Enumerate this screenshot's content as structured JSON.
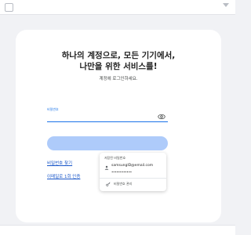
{
  "card": {
    "headline_line1": "하나의 계정으로, 모든 기기에서,",
    "headline_line2": "나만을 위한 서비스를!",
    "subtitle": "계정에 로그인하세요.",
    "password_label": "비밀번호",
    "password_value": "",
    "find_password_link": "비밀번호 찾기",
    "email_auth_link": "이메일로 1회 인증"
  },
  "autofill": {
    "title": "저장된 비밀번호",
    "account_email": "samsungID@email.com",
    "masked_password": "••••••••••••",
    "manage_label": "비밀번호 관리"
  },
  "icons": {
    "visibility": "eye-icon",
    "account": "account-icon",
    "manage": "key-icon"
  },
  "colors": {
    "accent": "#1a73e8",
    "button_disabled": "#aecbfa",
    "link": "#1a57c9",
    "page_background": "#f1f2f5"
  }
}
